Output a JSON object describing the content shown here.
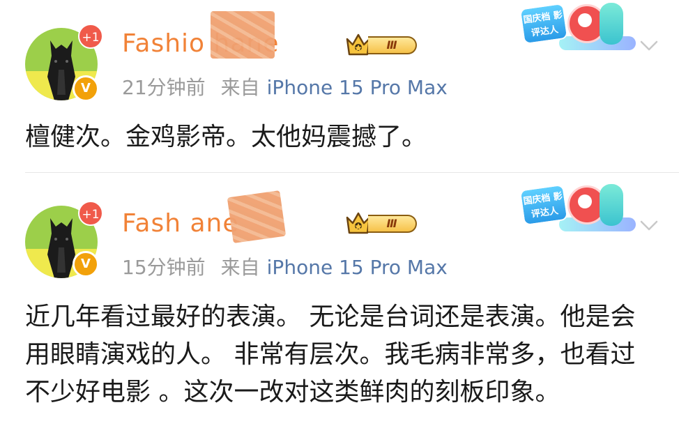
{
  "posts": [
    {
      "plus_badge": "+1",
      "name": "Fashio     hane",
      "level": "Ⅲ",
      "time": "21分钟前",
      "from": "来自",
      "device": "iPhone 15 Pro Max",
      "sticker_text": "国庆档 影评达人",
      "content": "檀健次。金鸡影帝。太他妈震撼了。"
    },
    {
      "plus_badge": "+1",
      "name": "Fash        ane",
      "level": "Ⅲ",
      "time": "15分钟前",
      "from": "来自",
      "device": "iPhone 15 Pro Max",
      "sticker_text": "国庆档 影评达人",
      "content": "近几年看过最好的表演。 无论是台词还是表演。他是会用眼睛演戏的人。 非常有层次。我毛病非常多，也看过不少好电影 。这次一改对这类鲜肉的刻板印象。"
    }
  ],
  "colors": {
    "name": "#f18237",
    "device_link": "#5577a8",
    "meta": "#9a9a9a",
    "verified": "#f2a10a",
    "plus_badge": "#f05a4a"
  },
  "icons": [
    "horse-avatar",
    "verified-v-icon",
    "crown-level-icon",
    "chevron-down-icon",
    "event-sticker"
  ]
}
